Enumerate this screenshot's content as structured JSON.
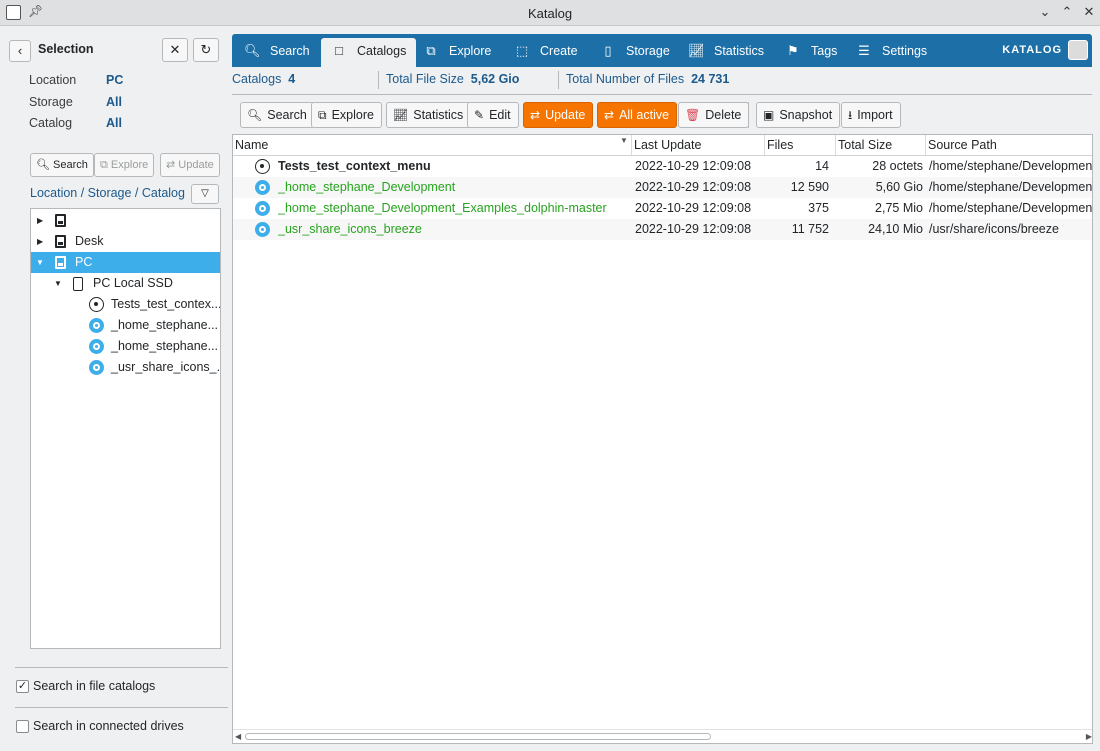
{
  "window": {
    "title": "Katalog",
    "pin_icon": "pin-icon"
  },
  "left": {
    "selection_title": "Selection",
    "fields": [
      {
        "key": "Location",
        "value": "PC"
      },
      {
        "key": "Storage",
        "value": "All"
      },
      {
        "key": "Catalog",
        "value": "All"
      }
    ],
    "buttons": {
      "search": "Search",
      "explore": "Explore",
      "update": "Update"
    },
    "path_label": "Location / Storage / Catalog",
    "tree": [
      {
        "label": ""
      },
      {
        "label": "Desk"
      },
      {
        "label": "PC"
      },
      {
        "label": "PC Local SSD"
      },
      {
        "label": "Tests_test_contex..."
      },
      {
        "label": "_home_stephane..."
      },
      {
        "label": "_home_stephane..."
      },
      {
        "label": "_usr_share_icons_..."
      }
    ],
    "search_file_catalogs": "Search in file catalogs",
    "search_file_catalogs_checked": true,
    "search_connected_drives": "Search in connected drives",
    "search_connected_drives_checked": false
  },
  "nav": {
    "tabs": [
      "Search",
      "Catalogs",
      "Explore",
      "Create",
      "Storage",
      "Statistics",
      "Tags",
      "Settings"
    ],
    "active": "Catalogs",
    "brand": "KATALOG"
  },
  "stats": {
    "catalogs_label": "Catalogs",
    "catalogs_value": "4",
    "total_size_label": "Total File Size",
    "total_size_value": "5,62 Gio",
    "total_files_label": "Total Number of Files",
    "total_files_value": "24 731"
  },
  "toolbar": {
    "search": "Search",
    "explore": "Explore",
    "statistics": "Statistics",
    "edit": "Edit",
    "update": "Update",
    "all_active": "All active",
    "delete": "Delete",
    "snapshot": "Snapshot",
    "import": "Import"
  },
  "table": {
    "headers": [
      "Name",
      "Last Update",
      "Files",
      "Total Size",
      "Source Path"
    ],
    "rows": [
      {
        "name": "Tests_test_context_menu",
        "last_update": "2022-10-29 12:09:08",
        "files": "14",
        "total_size": "28 octets",
        "source_path": "/home/stephane/Developmen"
      },
      {
        "name": "_home_stephane_Development",
        "last_update": "2022-10-29 12:09:08",
        "files": "12 590",
        "total_size": "5,60 Gio",
        "source_path": "/home/stephane/Developmen"
      },
      {
        "name": "_home_stephane_Development_Examples_dolphin-master",
        "last_update": "2022-10-29 12:09:08",
        "files": "375",
        "total_size": "2,75 Mio",
        "source_path": "/home/stephane/Developmen"
      },
      {
        "name": "_usr_share_icons_breeze",
        "last_update": "2022-10-29 12:09:08",
        "files": "11 752",
        "total_size": "24,10 Mio",
        "source_path": "/usr/share/icons/breeze"
      }
    ]
  },
  "colors": {
    "accent": "#1d6fa7",
    "selection": "#3daee9",
    "orange": "#f67400",
    "green": "#27a31f"
  }
}
